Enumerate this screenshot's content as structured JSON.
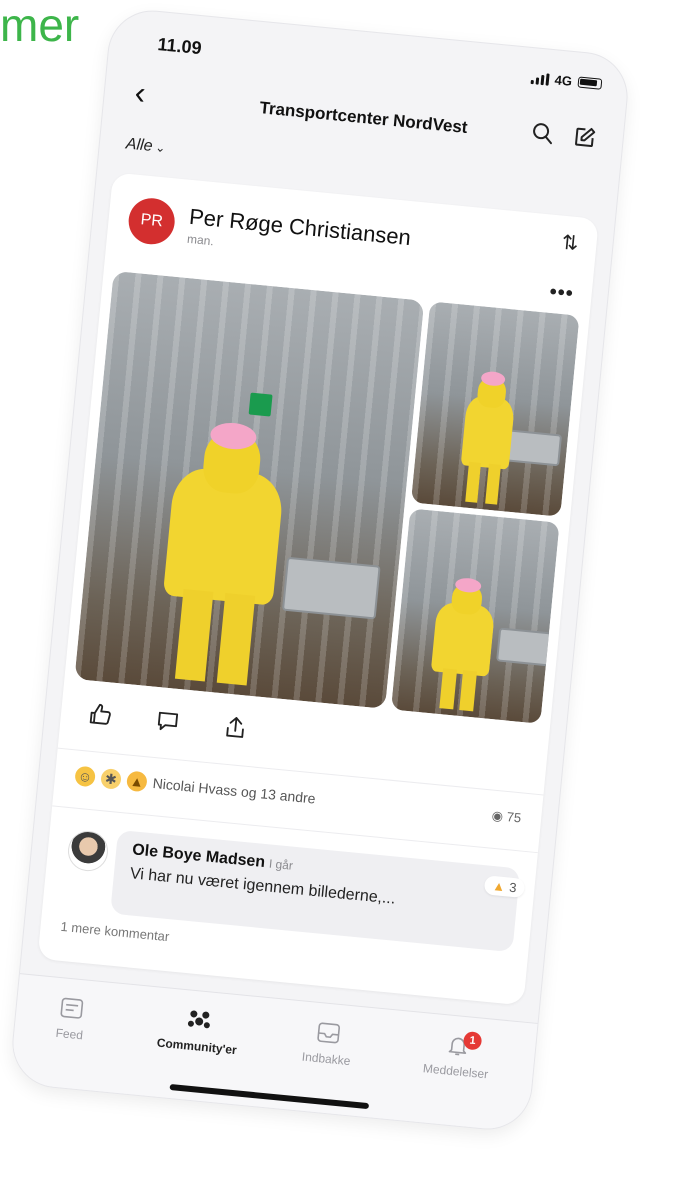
{
  "page_corner_text": "mer",
  "status": {
    "time": "11.09",
    "network": "4G"
  },
  "header": {
    "title": "Transportcenter NordVest",
    "filter_label": "Alle"
  },
  "post": {
    "avatar_initials": "PR",
    "author": "Per Røge Christiansen",
    "time": "man.",
    "reactions_text": "Nicolai Hvass og 13 andre",
    "views": "75"
  },
  "comment": {
    "author": "Ole Boye Madsen",
    "when": "I går",
    "text": "Vi har nu været igennem billederne,...",
    "like_count": "3",
    "more_comments": "1 mere kommentar"
  },
  "tabs": {
    "feed": "Feed",
    "communities": "Community'er",
    "inbox": "Indbakke",
    "notifications": "Meddelelser",
    "notification_badge": "1"
  },
  "colors": {
    "accent_green": "#3db54a",
    "avatar_red": "#d32f2f",
    "badge_red": "#e53935"
  }
}
